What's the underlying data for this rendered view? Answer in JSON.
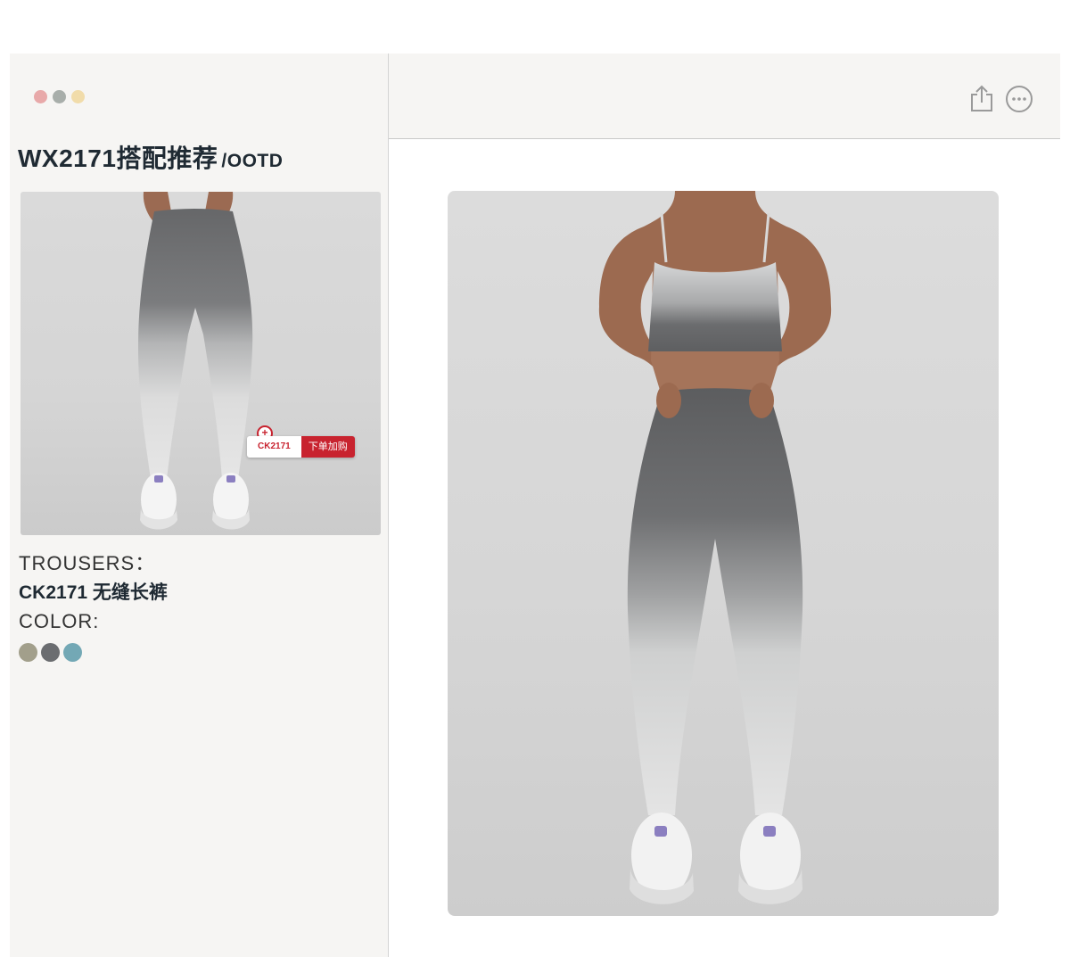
{
  "window": {
    "traffic_lights": [
      "#e8a9a9",
      "#a8aeaa",
      "#f1dcaa"
    ]
  },
  "sidebar": {
    "title": "WX2171搭配推荐",
    "title_suffix": "/OOTD",
    "thumbnail": {
      "tag_code": "CK2171",
      "tag_button": "下单加购",
      "accent": "#c8232f"
    },
    "trousers_label": "TROUSERS：",
    "product_name": "CK2171 无缝长裤",
    "color_label": "COLOR:",
    "color_swatches": [
      "#a29f8b",
      "#6b6d70",
      "#73a8b5"
    ]
  },
  "toolbar": {
    "icons": [
      "share-icon",
      "more-icon"
    ]
  }
}
